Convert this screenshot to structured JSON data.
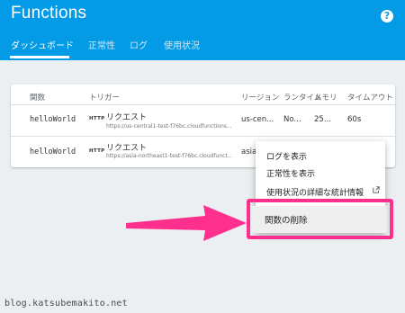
{
  "header": {
    "title": "Functions",
    "help_icon": "?"
  },
  "tabs": [
    {
      "label": "ダッシュボード",
      "active": true
    },
    {
      "label": "正常性",
      "active": false
    },
    {
      "label": "ログ",
      "active": false
    },
    {
      "label": "使用状況",
      "active": false
    }
  ],
  "table": {
    "columns": [
      "関数",
      "トリガー",
      "リージョン",
      "ランタイム",
      "メモリ",
      "タイムアウト"
    ],
    "rows": [
      {
        "name": "helloWorld",
        "trigger_badge": "HTTP",
        "trigger_type": "リクエスト",
        "trigger_url": "https://us-central1-test-f76bc.cloudfunctions...",
        "region": "us-cen...",
        "runtime": "No...",
        "memory": "25...",
        "timeout": "60s"
      },
      {
        "name": "helloWorld",
        "trigger_badge": "HTTP",
        "trigger_type": "リクエスト",
        "trigger_url": "https://asia-northeast1-test-f76bc.cloudfunct...",
        "region": "asia"
      }
    ]
  },
  "context_menu": {
    "items": [
      {
        "label": "ログを表示"
      },
      {
        "label": "正常性を表示"
      },
      {
        "label": "使用状況の詳細な統計情報",
        "icon": "open-in-new-icon"
      },
      {
        "label": "関数の削除"
      }
    ]
  },
  "colors": {
    "appbar": "#039be5",
    "highlight": "#ff2f8e"
  },
  "watermark": "blog.katsubemakito.net"
}
